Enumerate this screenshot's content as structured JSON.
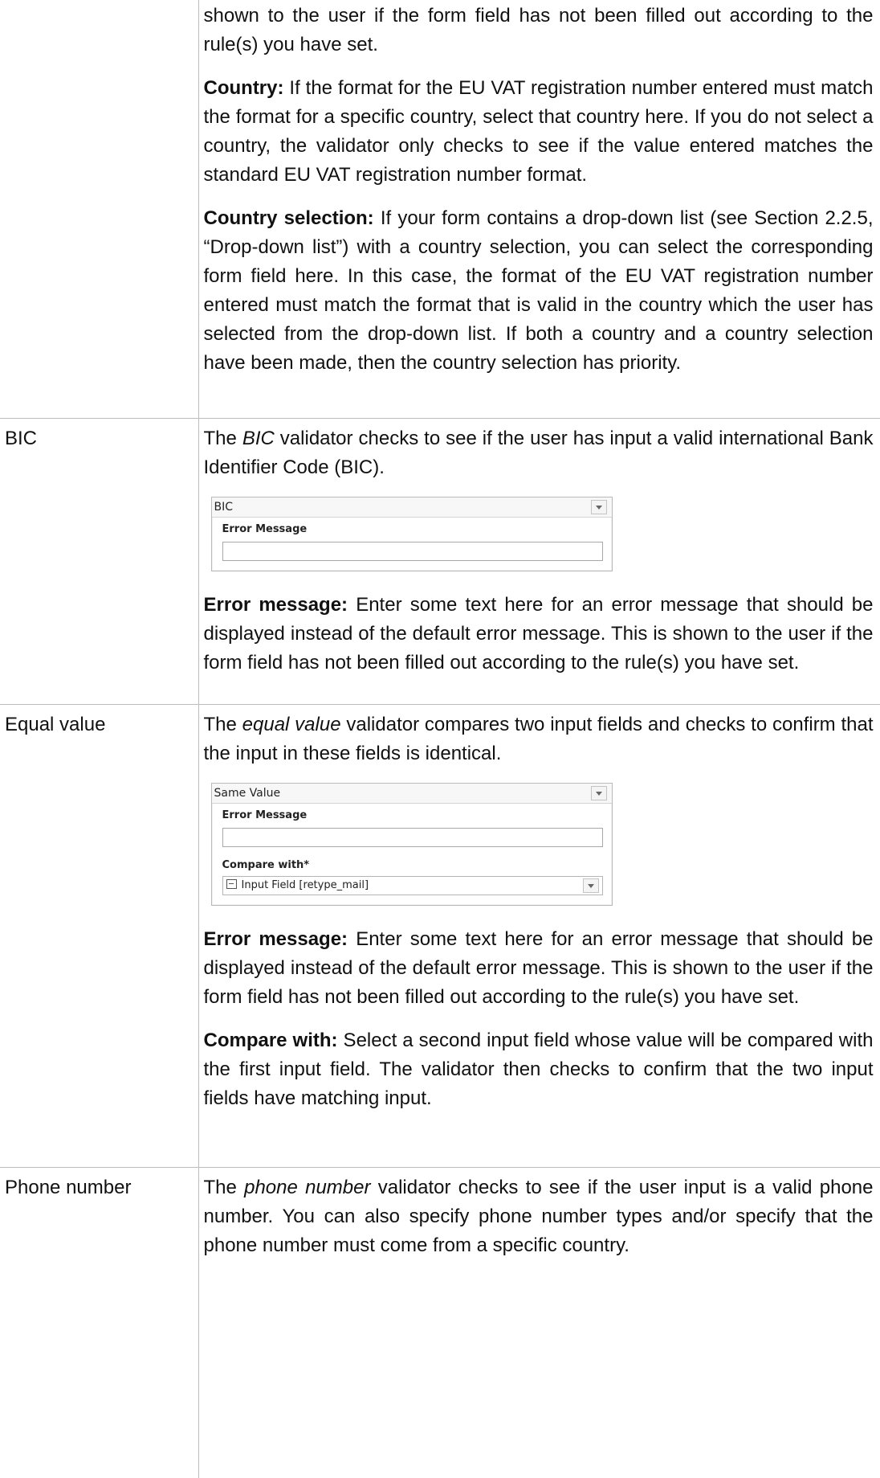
{
  "row1": {
    "paragraphs": [
      {
        "lead": "",
        "text": "shown to the user if the form field has not been filled out according to the rule(s) you have set."
      },
      {
        "lead": "Country:",
        "text": " If the format for the EU VAT registration number entered must match the format for a specific country, select that country here. If you do not select a country, the validator only checks to see if the value entered matches the standard EU VAT registration number format."
      },
      {
        "lead": "Country selection:",
        "text": " If your form contains a drop-down list (see Section 2.2.5, “Drop-down list”) with a country selection, you can select the corresponding form field here. In this case, the format of the EU VAT registration number entered must match the format that is valid in the country which the user has selected from the drop-down list. If both a country and a country selection have been made, then the country selection has priority."
      }
    ]
  },
  "bic": {
    "label": "BIC",
    "intro_pre": "The ",
    "intro_em": "BIC",
    "intro_post": " validator checks to see if the user has input a valid international Bank Identifier Code (BIC).",
    "widget": {
      "title": "BIC",
      "field_label": "Error Message",
      "field_value": ""
    },
    "error_lead": "Error message:",
    "error_text": " Enter some text here for an error message that should be displayed instead of the default error message. This is shown to the user if the form field has not been filled out according to the rule(s) you have set."
  },
  "equal": {
    "label": "Equal value",
    "intro_pre": "The ",
    "intro_em": "equal value",
    "intro_post": " validator compares two input fields and checks to confirm that the input in these fields is identical.",
    "widget": {
      "title": "Same Value",
      "field_label": "Error Message",
      "field_value": "",
      "compare_label": "Compare with*",
      "compare_value": "Input Field [retype_mail]",
      "compare_icon": "input-field-icon"
    },
    "error_lead": "Error message:",
    "error_text": " Enter some text here for an error message that should be displayed instead of the default error message. This is shown to the user if the form field has not been filled out according to the rule(s) you have set.",
    "compare_lead": "Compare with:",
    "compare_text": " Select a second input field whose value will be compared with the first input field. The validator then checks to confirm that the two input fields have matching input."
  },
  "phone": {
    "label": "Phone number",
    "intro_pre": "The ",
    "intro_em": "phone number",
    "intro_post": " validator checks to see if the user input is a valid phone number. You can also specify phone number types and/or specify that the phone number must come from a specific country."
  }
}
